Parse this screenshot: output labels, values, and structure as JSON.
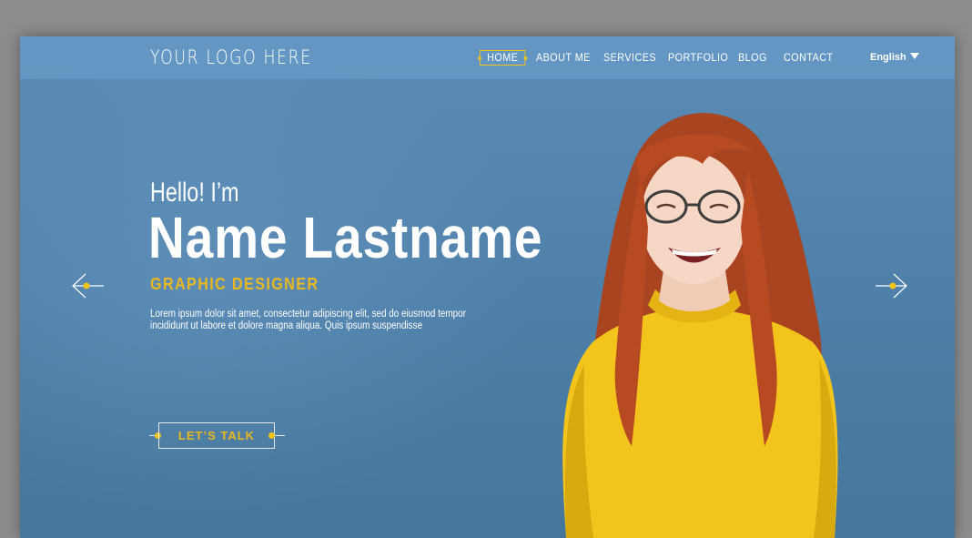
{
  "header": {
    "logo_text": "YOUR LOGO HERE",
    "nav": [
      {
        "label": "HOME",
        "active": true
      },
      {
        "label": "ABOUT ME"
      },
      {
        "label": "SERVICES"
      },
      {
        "label": "PORTFOLIO"
      },
      {
        "label": "BLOG"
      },
      {
        "label": "CONTACT"
      }
    ],
    "language": "English"
  },
  "hero": {
    "greeting": "Hello! I’m",
    "name": "Name Lastname",
    "role": "GRAPHIC DESIGNER",
    "description": "Lorem ipsum dolor sit amet, consectetur adipiscing elit, sed do eiusmod tempor incididunt ut labore et dolore magna aliqua. Quis ipsum suspendisse",
    "cta_label": "LET’S TALK"
  },
  "colors": {
    "background": "#4d7fa9",
    "accent": "#e8b820",
    "sweater": "#f2c41c",
    "hair": "#b84a22"
  },
  "icons": {
    "prev": "arrow-left-icon",
    "next": "arrow-right-icon",
    "language": "caret-down-icon"
  }
}
